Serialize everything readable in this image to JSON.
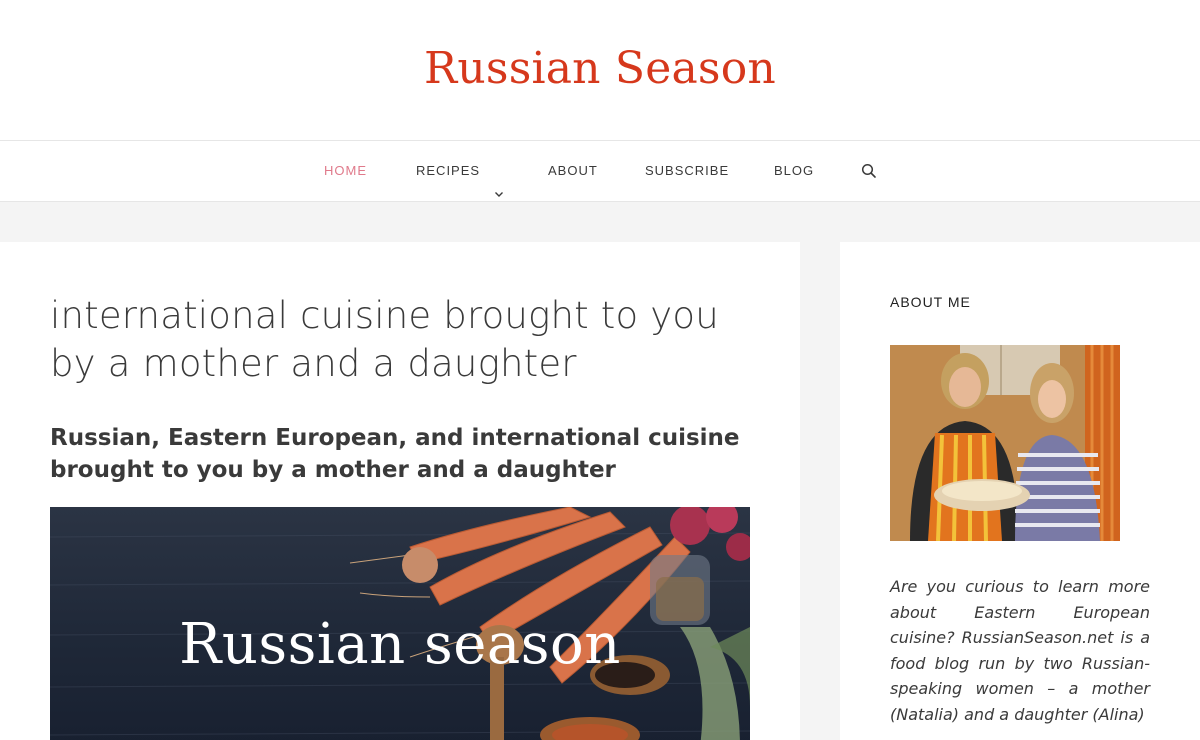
{
  "site": {
    "title": "Russian Season"
  },
  "nav": {
    "items": [
      {
        "label": "HOME",
        "active": true
      },
      {
        "label": "RECIPES",
        "has_dropdown": true
      },
      {
        "label": "ABOUT"
      },
      {
        "label": "SUBSCRIBE"
      },
      {
        "label": "BLOG"
      }
    ],
    "search_icon": "search-icon",
    "active_color": "#e07a8b"
  },
  "main": {
    "heading": "international cuisine brought to you by a mother and a daughter",
    "subheading": "Russian, Eastern European, and international cuisine brought to you by a mother and a daughter",
    "hero_text": "Russian season"
  },
  "sidebar": {
    "widget_title": "ABOUT ME",
    "about_text": "Are you curious to learn more about Eastern European cuisine? RussianSeason.net is a food blog run by two Russian-speaking women – a mother (Natalia) and a daughter (Alina)"
  },
  "colors": {
    "brand": "#d6381c",
    "text": "#3a3a3a",
    "background": "#f4f4f4"
  }
}
